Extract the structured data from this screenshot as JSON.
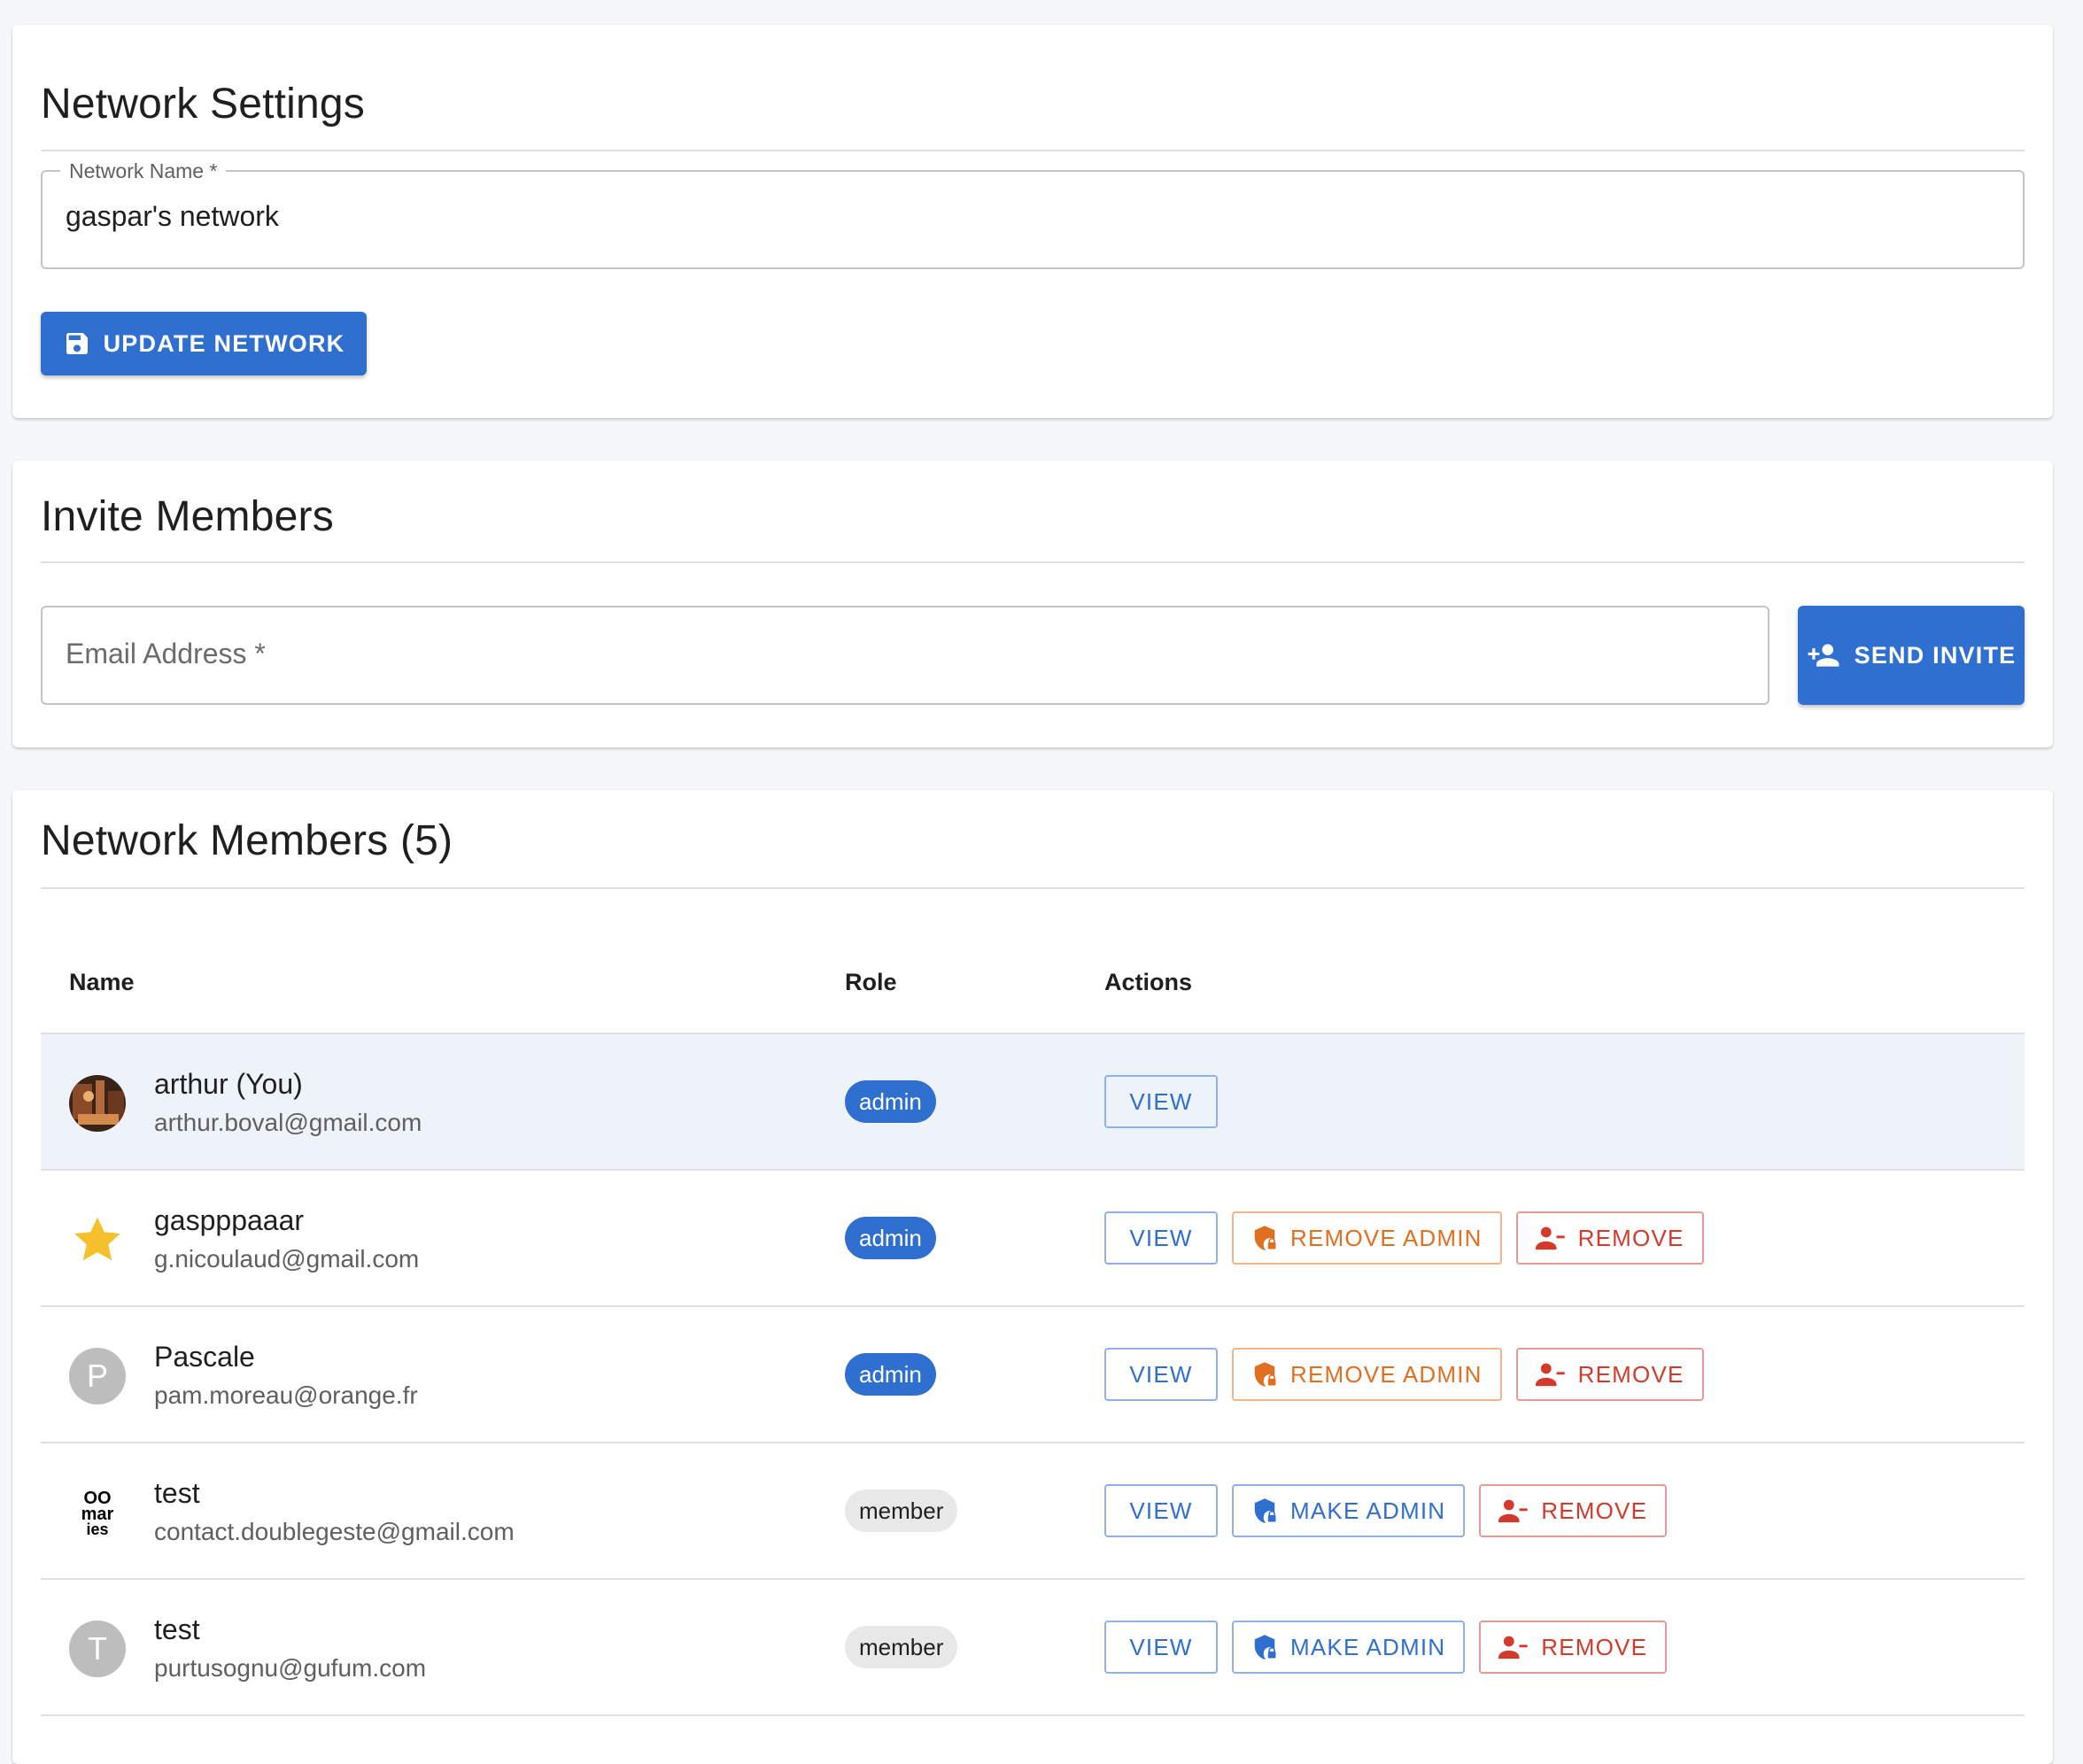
{
  "settings": {
    "title": "Network Settings",
    "name_label": "Network Name *",
    "name_value": "gaspar's network",
    "update_button": "UPDATE NETWORK"
  },
  "invite": {
    "title": "Invite Members",
    "email_placeholder": "Email Address *",
    "send_button": "SEND INVITE"
  },
  "members": {
    "title": "Network Members (5)",
    "columns": {
      "name": "Name",
      "role": "Role",
      "actions": "Actions"
    },
    "rows": [
      {
        "name": "arthur (You)",
        "email": "arthur.boval@gmail.com",
        "role": "admin",
        "avatar": "photo"
      },
      {
        "name": "gaspppaaar",
        "email": "g.nicoulaud@gmail.com",
        "role": "admin",
        "avatar": "star"
      },
      {
        "name": "Pascale",
        "email": "pam.moreau@orange.fr",
        "role": "admin",
        "avatar_letter": "P"
      },
      {
        "name": "test",
        "email": "contact.doublegeste@gmail.com",
        "role": "member",
        "avatar": "logo",
        "logo_text": [
          "OO",
          "mar",
          "ies"
        ]
      },
      {
        "name": "test",
        "email": "purtusognu@gufum.com",
        "role": "member",
        "avatar_letter": "T"
      }
    ],
    "labels": {
      "view": "VIEW",
      "remove_admin": "REMOVE ADMIN",
      "make_admin": "MAKE ADMIN",
      "remove": "REMOVE"
    }
  },
  "colors": {
    "primary": "#2f6fcf",
    "orange": "#e07020",
    "red": "#d33a2c",
    "row_highlight": "#eef3fa",
    "star": "#f5c02b"
  },
  "icons": {
    "update_button": "save-icon",
    "send_button": "person-add-icon",
    "remove_admin": "shield-lock-icon",
    "make_admin": "shield-lock-icon",
    "remove": "person-remove-icon"
  }
}
